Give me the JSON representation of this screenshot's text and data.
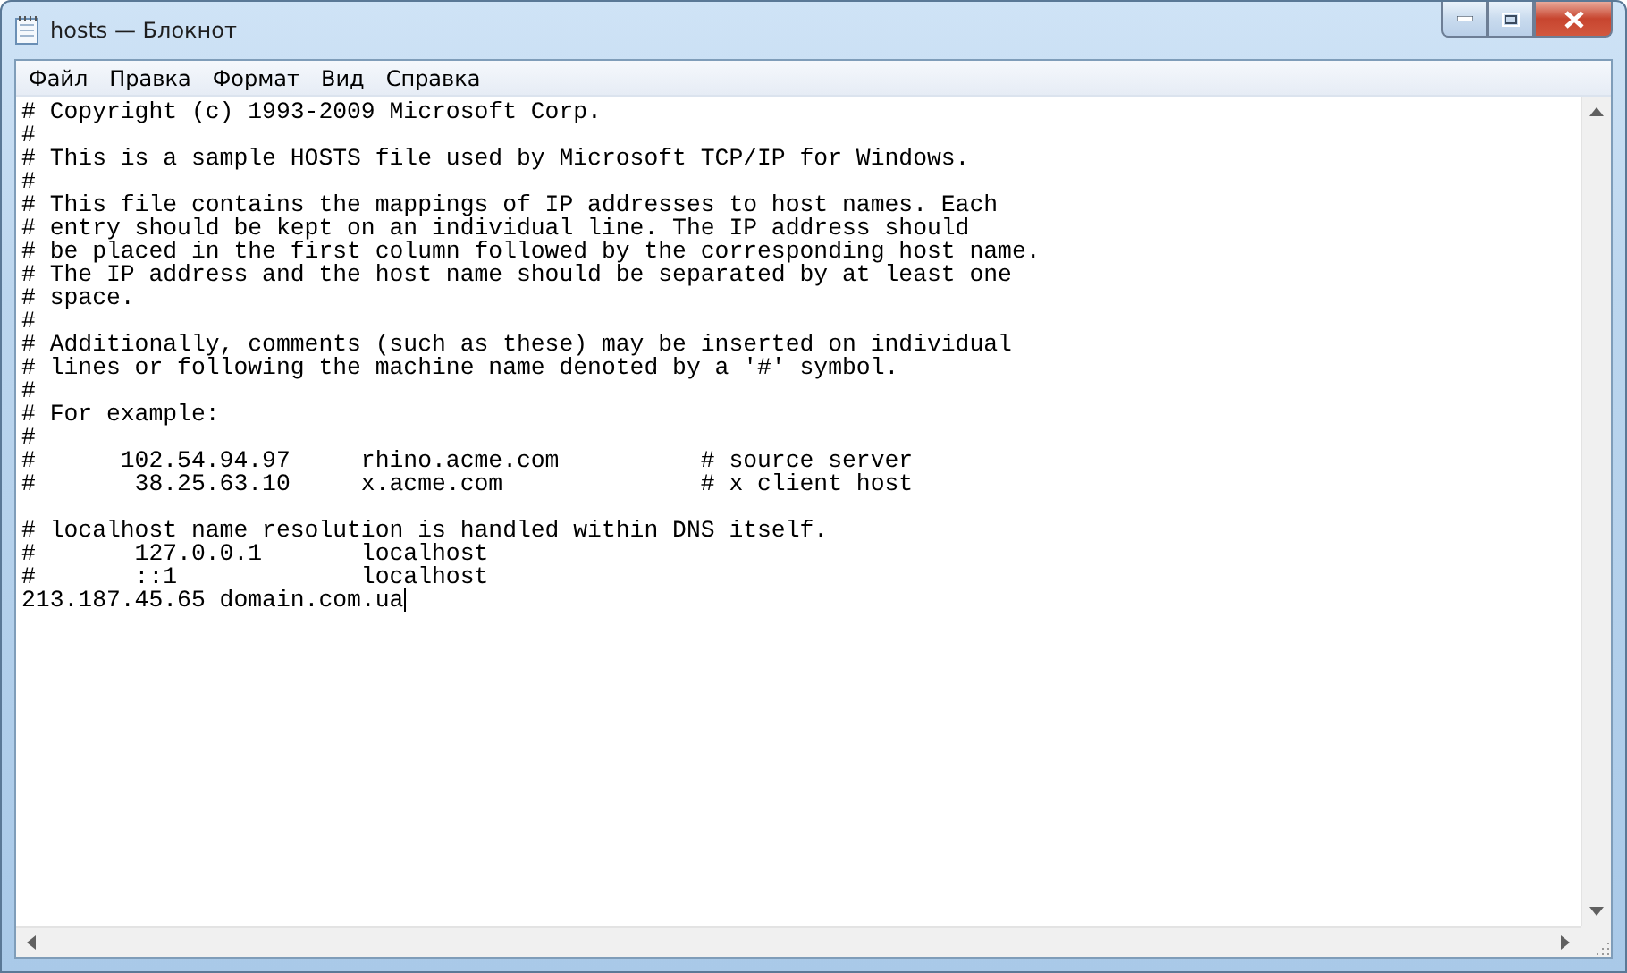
{
  "window": {
    "title": "hosts — Блокнот"
  },
  "menu": [
    "Файл",
    "Правка",
    "Формат",
    "Вид",
    "Справка"
  ],
  "editor": {
    "content": "# Copyright (c) 1993-2009 Microsoft Corp.\n#\n# This is a sample HOSTS file used by Microsoft TCP/IP for Windows.\n#\n# This file contains the mappings of IP addresses to host names. Each\n# entry should be kept on an individual line. The IP address should\n# be placed in the first column followed by the corresponding host name.\n# The IP address and the host name should be separated by at least one\n# space.\n#\n# Additionally, comments (such as these) may be inserted on individual\n# lines or following the machine name denoted by a '#' symbol.\n#\n# For example:\n#\n#      102.54.94.97     rhino.acme.com          # source server\n#       38.25.63.10     x.acme.com              # x client host\n\n# localhost name resolution is handled within DNS itself.\n#       127.0.0.1       localhost\n#       ::1             localhost\n213.187.45.65 domain.com.ua"
  }
}
